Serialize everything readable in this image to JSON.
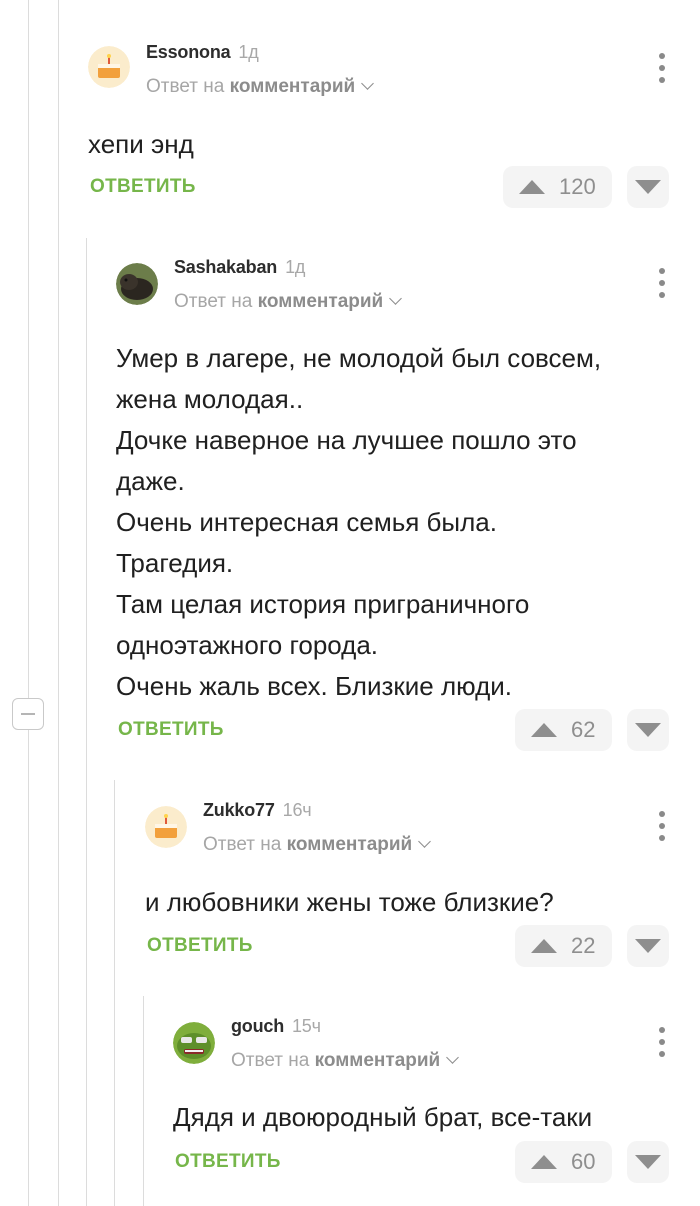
{
  "labels": {
    "reply_prefix": "Ответ на",
    "reply_target": "комментарий",
    "reply_button": "ОТВЕТИТЬ"
  },
  "comments": [
    {
      "author": "Essonona",
      "time": "1д",
      "text": "хепи энд",
      "rating": "120",
      "avatar": "cake-avatar"
    },
    {
      "author": "Sashakaban",
      "time": "1д",
      "text": "Умер в лагере, не молодой был совсем,\nжена молодая..\nДочке наверное на лучшее пошло это\nдаже.\nОчень интересная семья была.\nТрагедия.\nТам целая история приграничного\nодноэтажного города.\nОчень жаль всех. Близкие люди.",
      "rating": "62",
      "avatar": "boar-avatar"
    },
    {
      "author": "Zukko77",
      "time": "16ч",
      "text": "и любовники жены тоже близкие?",
      "rating": "22",
      "avatar": "cake-avatar"
    },
    {
      "author": "gouch",
      "time": "15ч",
      "text": "Дядя и двоюродный брат, все-таки",
      "rating": "60",
      "avatar": "frog-avatar"
    }
  ],
  "colors": {
    "accent": "#76b64a",
    "muted": "#a6a6a6",
    "vote_bg": "#f4f4f4"
  }
}
